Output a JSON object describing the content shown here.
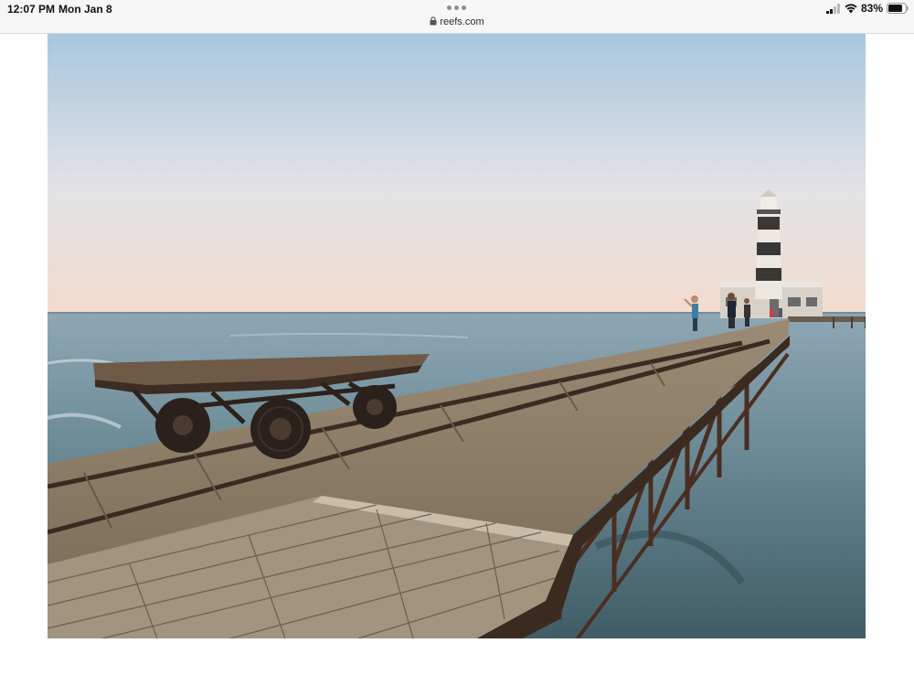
{
  "status_bar": {
    "time": "12:07 PM",
    "date": "Mon Jan 8",
    "battery": "83%",
    "battery_level": 0.83,
    "signal_icon": "cellular-signal-icon",
    "wifi_icon": "wifi-icon",
    "battery_icon": "battery-icon"
  },
  "browser": {
    "url": "reefs.com",
    "lock_icon": "lock-icon",
    "more_icon": "more-dots-icon"
  },
  "article": {
    "image_alt": "",
    "caption_visible": ""
  },
  "colors": {
    "sky_top": "#a9c7df",
    "sky_horizon": "#f2dccd",
    "sea": "#6d8c98",
    "deck": "#8c7a64",
    "lighthouse_dark": "#3a3836"
  }
}
